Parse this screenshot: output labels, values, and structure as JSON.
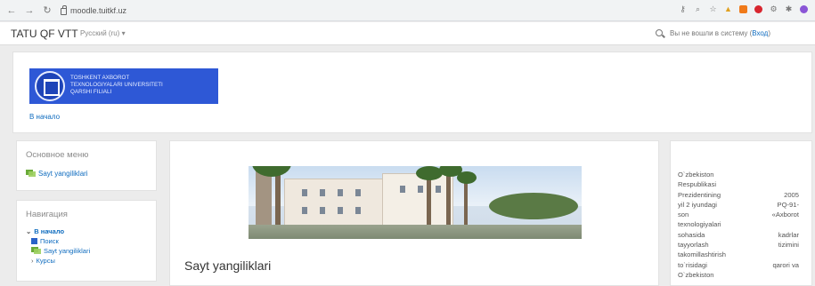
{
  "browser": {
    "url": "moodle.tuitkf.uz"
  },
  "navbar": {
    "brand": "TATU QF VTT",
    "language": "Русский (ru) ▾",
    "login_text": "Вы не вошли в систему (",
    "login_link": "Вход",
    "login_close": ")"
  },
  "header": {
    "logo_lines": [
      "TOSHKENT AXBOROT",
      "TEXNOLOGIYALARI UNIVERSITETI",
      "QARSHI FILIALI"
    ],
    "breadcrumb_home": "В начало"
  },
  "main_menu_block": {
    "title": "Основное меню",
    "item": "Sayt yangiliklari"
  },
  "navigation_block": {
    "title": "Навигация",
    "home": "В начало",
    "items": [
      "Поиск",
      "Sayt yangiliklari",
      "Курсы"
    ]
  },
  "main": {
    "section_title": "Sayt yangiliklari"
  },
  "right_block": {
    "lines": [
      [
        "O`zbekiston",
        ""
      ],
      [
        "Respublikasi",
        ""
      ],
      [
        "Prezidentining",
        "2005"
      ],
      [
        "yil 2 iyundagi",
        "PQ-91-"
      ],
      [
        "son",
        "«Axborot"
      ],
      [
        "texnologiyalari",
        ""
      ],
      [
        "sohasida",
        "kadrlar"
      ],
      [
        "tayyorlash",
        "tizimini"
      ],
      [
        "takomillashtirish",
        ""
      ],
      [
        "to`risidagi",
        "qarori va"
      ],
      [
        "O`zbekiston",
        ""
      ]
    ]
  }
}
